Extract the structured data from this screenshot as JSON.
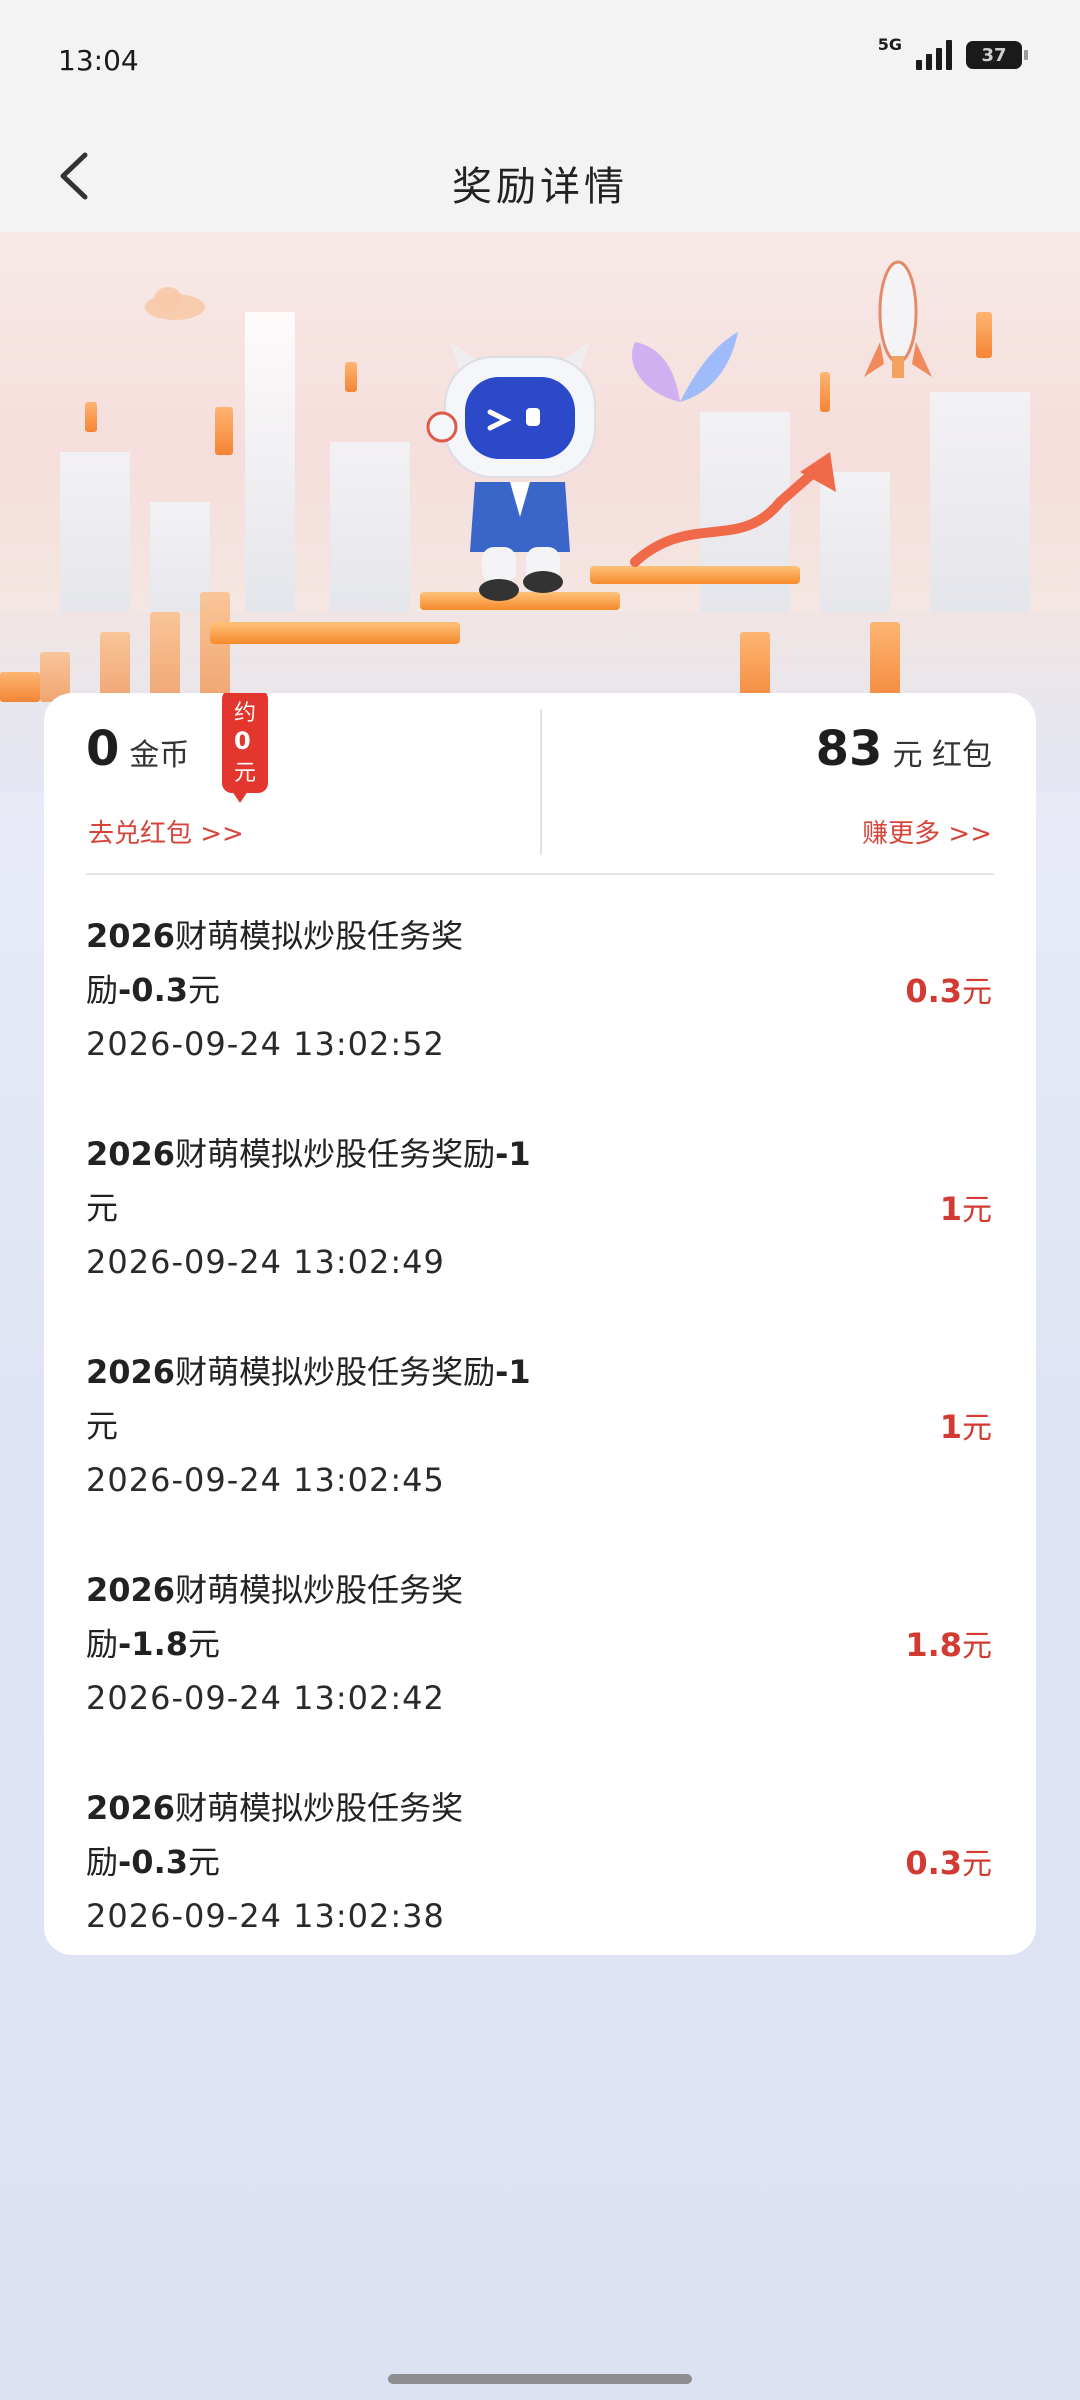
{
  "status_bar": {
    "time": "13:04",
    "network": "5G",
    "battery": "37"
  },
  "header": {
    "title": "奖励详情",
    "back_icon": "chevron-left-icon"
  },
  "summary": {
    "coins": {
      "value": "0",
      "unit": "金币",
      "badge": {
        "prefix": "约",
        "value": "0",
        "unit": "元"
      },
      "link": "去兑红包 >>"
    },
    "red_packet": {
      "value": "83",
      "unit": "元 红包",
      "link": "赚更多 >>"
    }
  },
  "records": [
    {
      "title_a": "2026",
      "title_b": "财萌模拟炒股任务奖",
      "title_c": "励",
      "title_d": "-0.3",
      "title_e": "元",
      "time": "2026-09-24 13:02:52",
      "amount": "0.3",
      "amount_unit": "元"
    },
    {
      "title_a": "2026",
      "title_b": "财萌模拟炒股任务奖励",
      "title_c": "",
      "title_d": "-1",
      "title_e": "元",
      "time": "2026-09-24 13:02:49",
      "amount": "1",
      "amount_unit": "元"
    },
    {
      "title_a": "2026",
      "title_b": "财萌模拟炒股任务奖励",
      "title_c": "",
      "title_d": "-1",
      "title_e": "元",
      "time": "2026-09-24 13:02:45",
      "amount": "1",
      "amount_unit": "元"
    },
    {
      "title_a": "2026",
      "title_b": "财萌模拟炒股任务奖",
      "title_c": "励",
      "title_d": "-1.8",
      "title_e": "元",
      "time": "2026-09-24 13:02:42",
      "amount": "1.8",
      "amount_unit": "元"
    },
    {
      "title_a": "2026",
      "title_b": "财萌模拟炒股任务奖",
      "title_c": "励",
      "title_d": "-0.3",
      "title_e": "元",
      "time": "2026-09-24 13:02:38",
      "amount": "0.3",
      "amount_unit": "元"
    }
  ],
  "colors": {
    "accent_red": "#d23a32",
    "badge_red": "#e2362e",
    "banner_orange": "#f47a22"
  }
}
